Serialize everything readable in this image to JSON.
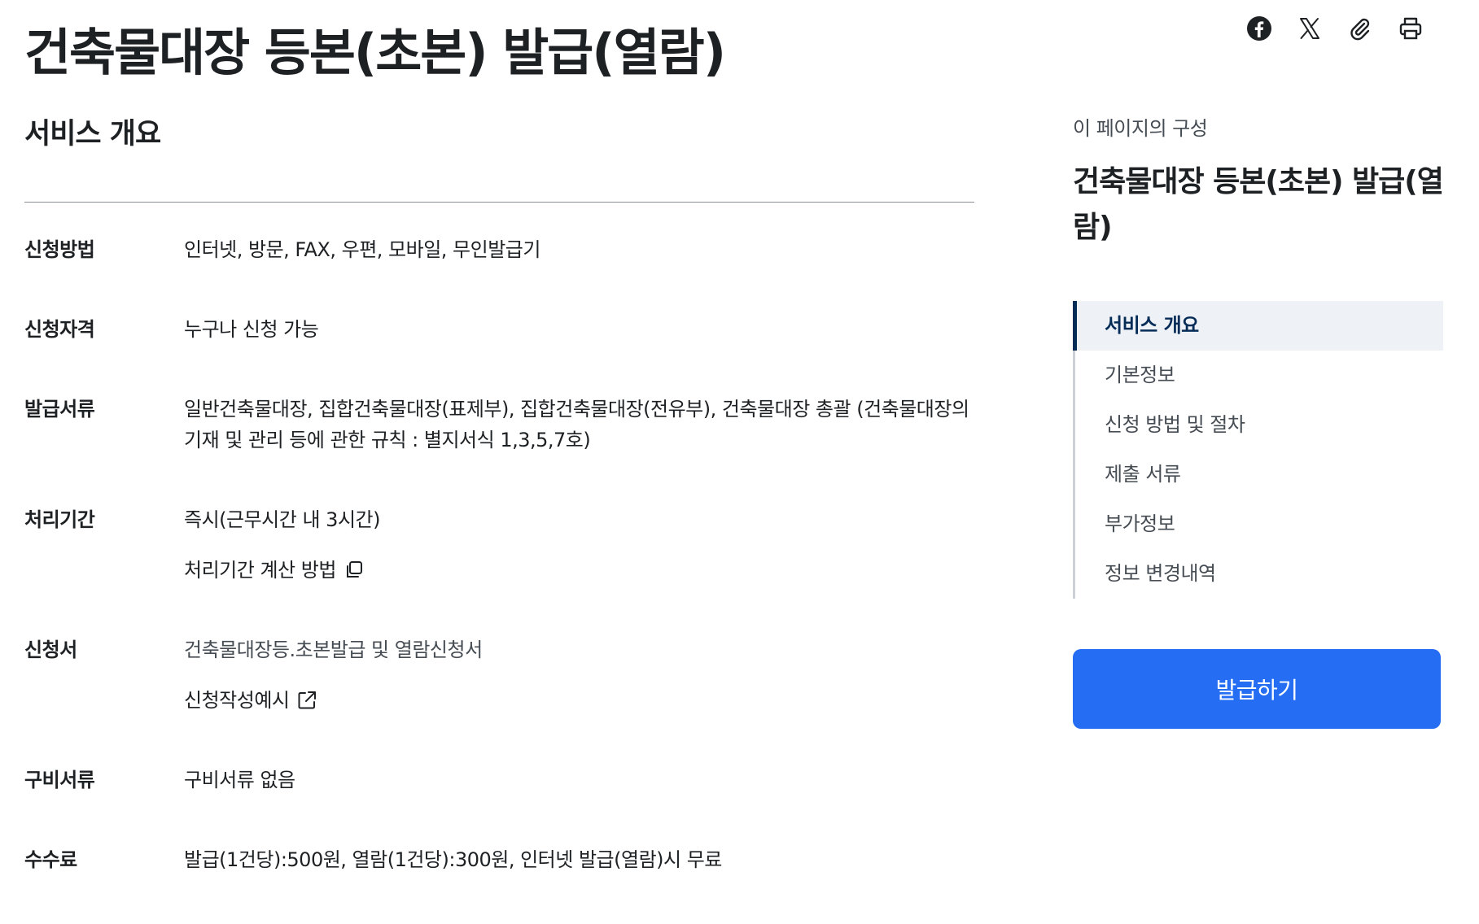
{
  "page": {
    "title": "건축물대장 등본(초본) 발급(열람)"
  },
  "share": {
    "icons": [
      "facebook-icon",
      "x-icon",
      "paperclip-icon",
      "printer-icon"
    ]
  },
  "overview": {
    "heading": "서비스 개요",
    "rows": [
      {
        "label": "신청방법",
        "value": "인터넷, 방문, FAX, 우편, 모바일, 무인발급기"
      },
      {
        "label": "신청자격",
        "value": "누구나 신청 가능"
      },
      {
        "label": "발급서류",
        "value": "일반건축물대장, 집합건축물대장(표제부), 집합건축물대장(전유부), 건축물대장 총괄 (건축물대장의 기재 및 관리 등에 관한 규칙 : 별지서식 1,3,5,7호)"
      },
      {
        "label": "처리기간",
        "value": "즉시(근무시간 내 3시간)",
        "link": "처리기간 계산 방법"
      },
      {
        "label": "신청서",
        "value": "건축물대장등.초본발급 및 열람신청서",
        "link": "신청작성예시"
      },
      {
        "label": "구비서류",
        "value": "구비서류 없음"
      },
      {
        "label": "수수료",
        "value": "발급(1건당):500원, 열람(1건당):300원, 인터넷 발급(열람)시 무료"
      }
    ]
  },
  "toc": {
    "caption": "이 페이지의 구성",
    "title": "건축물대장 등본(초본) 발급(열람)",
    "items": [
      "서비스 개요",
      "기본정보",
      "신청 방법 및 절차",
      "제출 서류",
      "부가정보",
      "정보 변경내역"
    ],
    "active_index": 0
  },
  "action": {
    "label": "발급하기"
  },
  "colors": {
    "primary": "#256ef4",
    "toc_active": "#052b57",
    "text": "#1e2124"
  }
}
